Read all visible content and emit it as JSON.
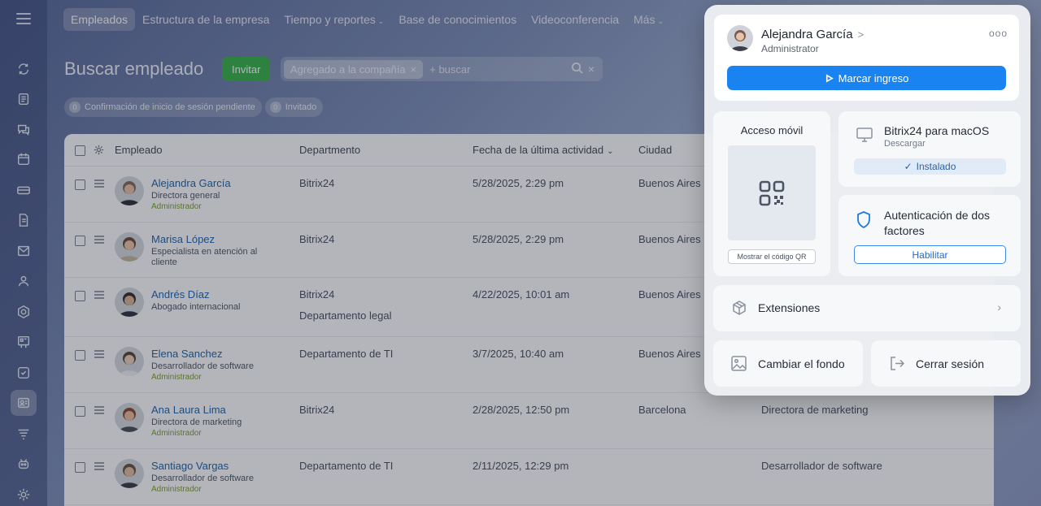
{
  "nav": {
    "tabs": [
      {
        "label": "Empleados",
        "active": true
      },
      {
        "label": "Estructura de la empresa"
      },
      {
        "label": "Tiempo y reportes"
      },
      {
        "label": "Base de conocimientos"
      },
      {
        "label": "Videoconferencia"
      },
      {
        "label": "Más"
      }
    ]
  },
  "sidebar_icons": [
    "menu-icon",
    "sync-icon",
    "feed-icon",
    "chat-icon",
    "calendar-icon",
    "drive-icon",
    "document-icon",
    "mail-icon",
    "team-icon",
    "hexagon-icon",
    "board-icon",
    "tasks-icon",
    "employees-icon",
    "filter-icon",
    "bot-icon",
    "settings-icon"
  ],
  "header": {
    "title": "Buscar empleado",
    "invite": "Invitar",
    "filter_chip": "Agregado a la compañía",
    "search_placeholder": "+ buscar",
    "counters": [
      {
        "count": "0",
        "label": "Confirmación de inicio de sesión pendiente"
      },
      {
        "count": "0",
        "label": "Invitado"
      }
    ]
  },
  "table": {
    "columns": {
      "employee": "Empleado",
      "department": "Departmento",
      "last_activity": "Fecha de la última actividad",
      "city": "Ciudad"
    },
    "rows": [
      {
        "name": "Alejandra García",
        "position": "Directora general",
        "role": "Administrador",
        "department": "Bitrix24",
        "department2": "",
        "activity": "5/28/2025, 2:29 pm",
        "city": "Buenos Aires",
        "extra": ""
      },
      {
        "name": "Marisa López",
        "position": "Especialista en atención al cliente",
        "role": "",
        "department": "Bitrix24",
        "department2": "",
        "activity": "5/28/2025, 2:29 pm",
        "city": "Buenos Aires",
        "extra": ""
      },
      {
        "name": "Andrés Díaz",
        "position": "Abogado internacional",
        "role": "",
        "department": "Bitrix24",
        "department2": "Departamento legal",
        "activity": "4/22/2025, 10:01 am",
        "city": "Buenos Aires",
        "extra": ""
      },
      {
        "name": "Elena Sanchez",
        "position": "Desarrollador de software",
        "role": "Administrador",
        "department": "Departamento de TI",
        "department2": "",
        "activity": "3/7/2025, 10:40 am",
        "city": "Buenos Aires",
        "extra": ""
      },
      {
        "name": "Ana Laura Lima",
        "position": "Directora de marketing",
        "role": "Administrador",
        "department": "Bitrix24",
        "department2": "",
        "activity": "2/28/2025, 12:50 pm",
        "city": "Barcelona",
        "extra": "Directora de marketing"
      },
      {
        "name": "Santiago Vargas",
        "position": "Desarrollador de software",
        "role": "Administrador",
        "department": "Departamento de TI",
        "department2": "",
        "activity": "2/11/2025, 12:29 pm",
        "city": "",
        "extra": "Desarrollador de software"
      }
    ]
  },
  "popup": {
    "user_name": "Alejandra García",
    "user_role": "Administrator",
    "more": "ooo",
    "checkin": "Marcar ingreso",
    "mobile_title": "Acceso móvil",
    "qr_button": "Mostrar el código QR",
    "mac_title": "Bitrix24 para macOS",
    "mac_sub": "Descargar",
    "installed": "Instalado",
    "twofa_title": "Autenticación de dos factores",
    "enable": "Habilitar",
    "extensions": "Extensiones",
    "change_bg": "Cambiar el fondo",
    "logout": "Cerrar sesión"
  },
  "colors": {
    "accent": "#1a83f2",
    "invite": "#3bb44a",
    "link": "#2067b0",
    "admin_role": "#7ba529"
  }
}
